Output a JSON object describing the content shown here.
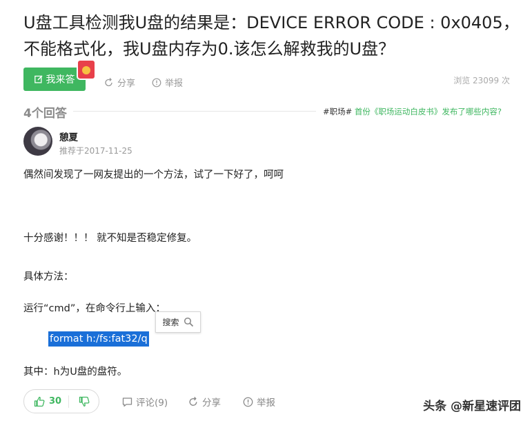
{
  "question": {
    "title": "U盘工具检测我U盘的结果是：DEVICE ERROR CODE : 0x0405，不能格式化，我U盘内存为0.该怎么解救我的U盘？",
    "answer_button": "我来答",
    "share": "分享",
    "report": "举报",
    "views": "浏览 23099 次"
  },
  "answers_header": {
    "count": "4个回答",
    "topic_tag": "#职场#",
    "topic_text": " 首份《职场运动白皮书》发布了哪些内容?"
  },
  "answer": {
    "username": "憩夏",
    "date": "推荐于2017-11-25",
    "p1": "偶然间发现了一网友提出的一个方法，试了一下好了，呵呵",
    "p2": "十分感谢！！！ 就不知是否稳定修复。",
    "p3": "具体方法：",
    "p4": "运行“cmd”，在命令行上输入：",
    "code": "format h:/fs:fat32/q",
    "p5": "其中：h为U盘的盘符。",
    "search_popup": "搜索"
  },
  "footer": {
    "likes": "30",
    "comments": "评论(9)",
    "share": "分享",
    "report": "举报",
    "watermark": "头条 @新星速评团"
  },
  "colors": {
    "accent": "#3fb760",
    "selection": "#1a6fd8"
  }
}
